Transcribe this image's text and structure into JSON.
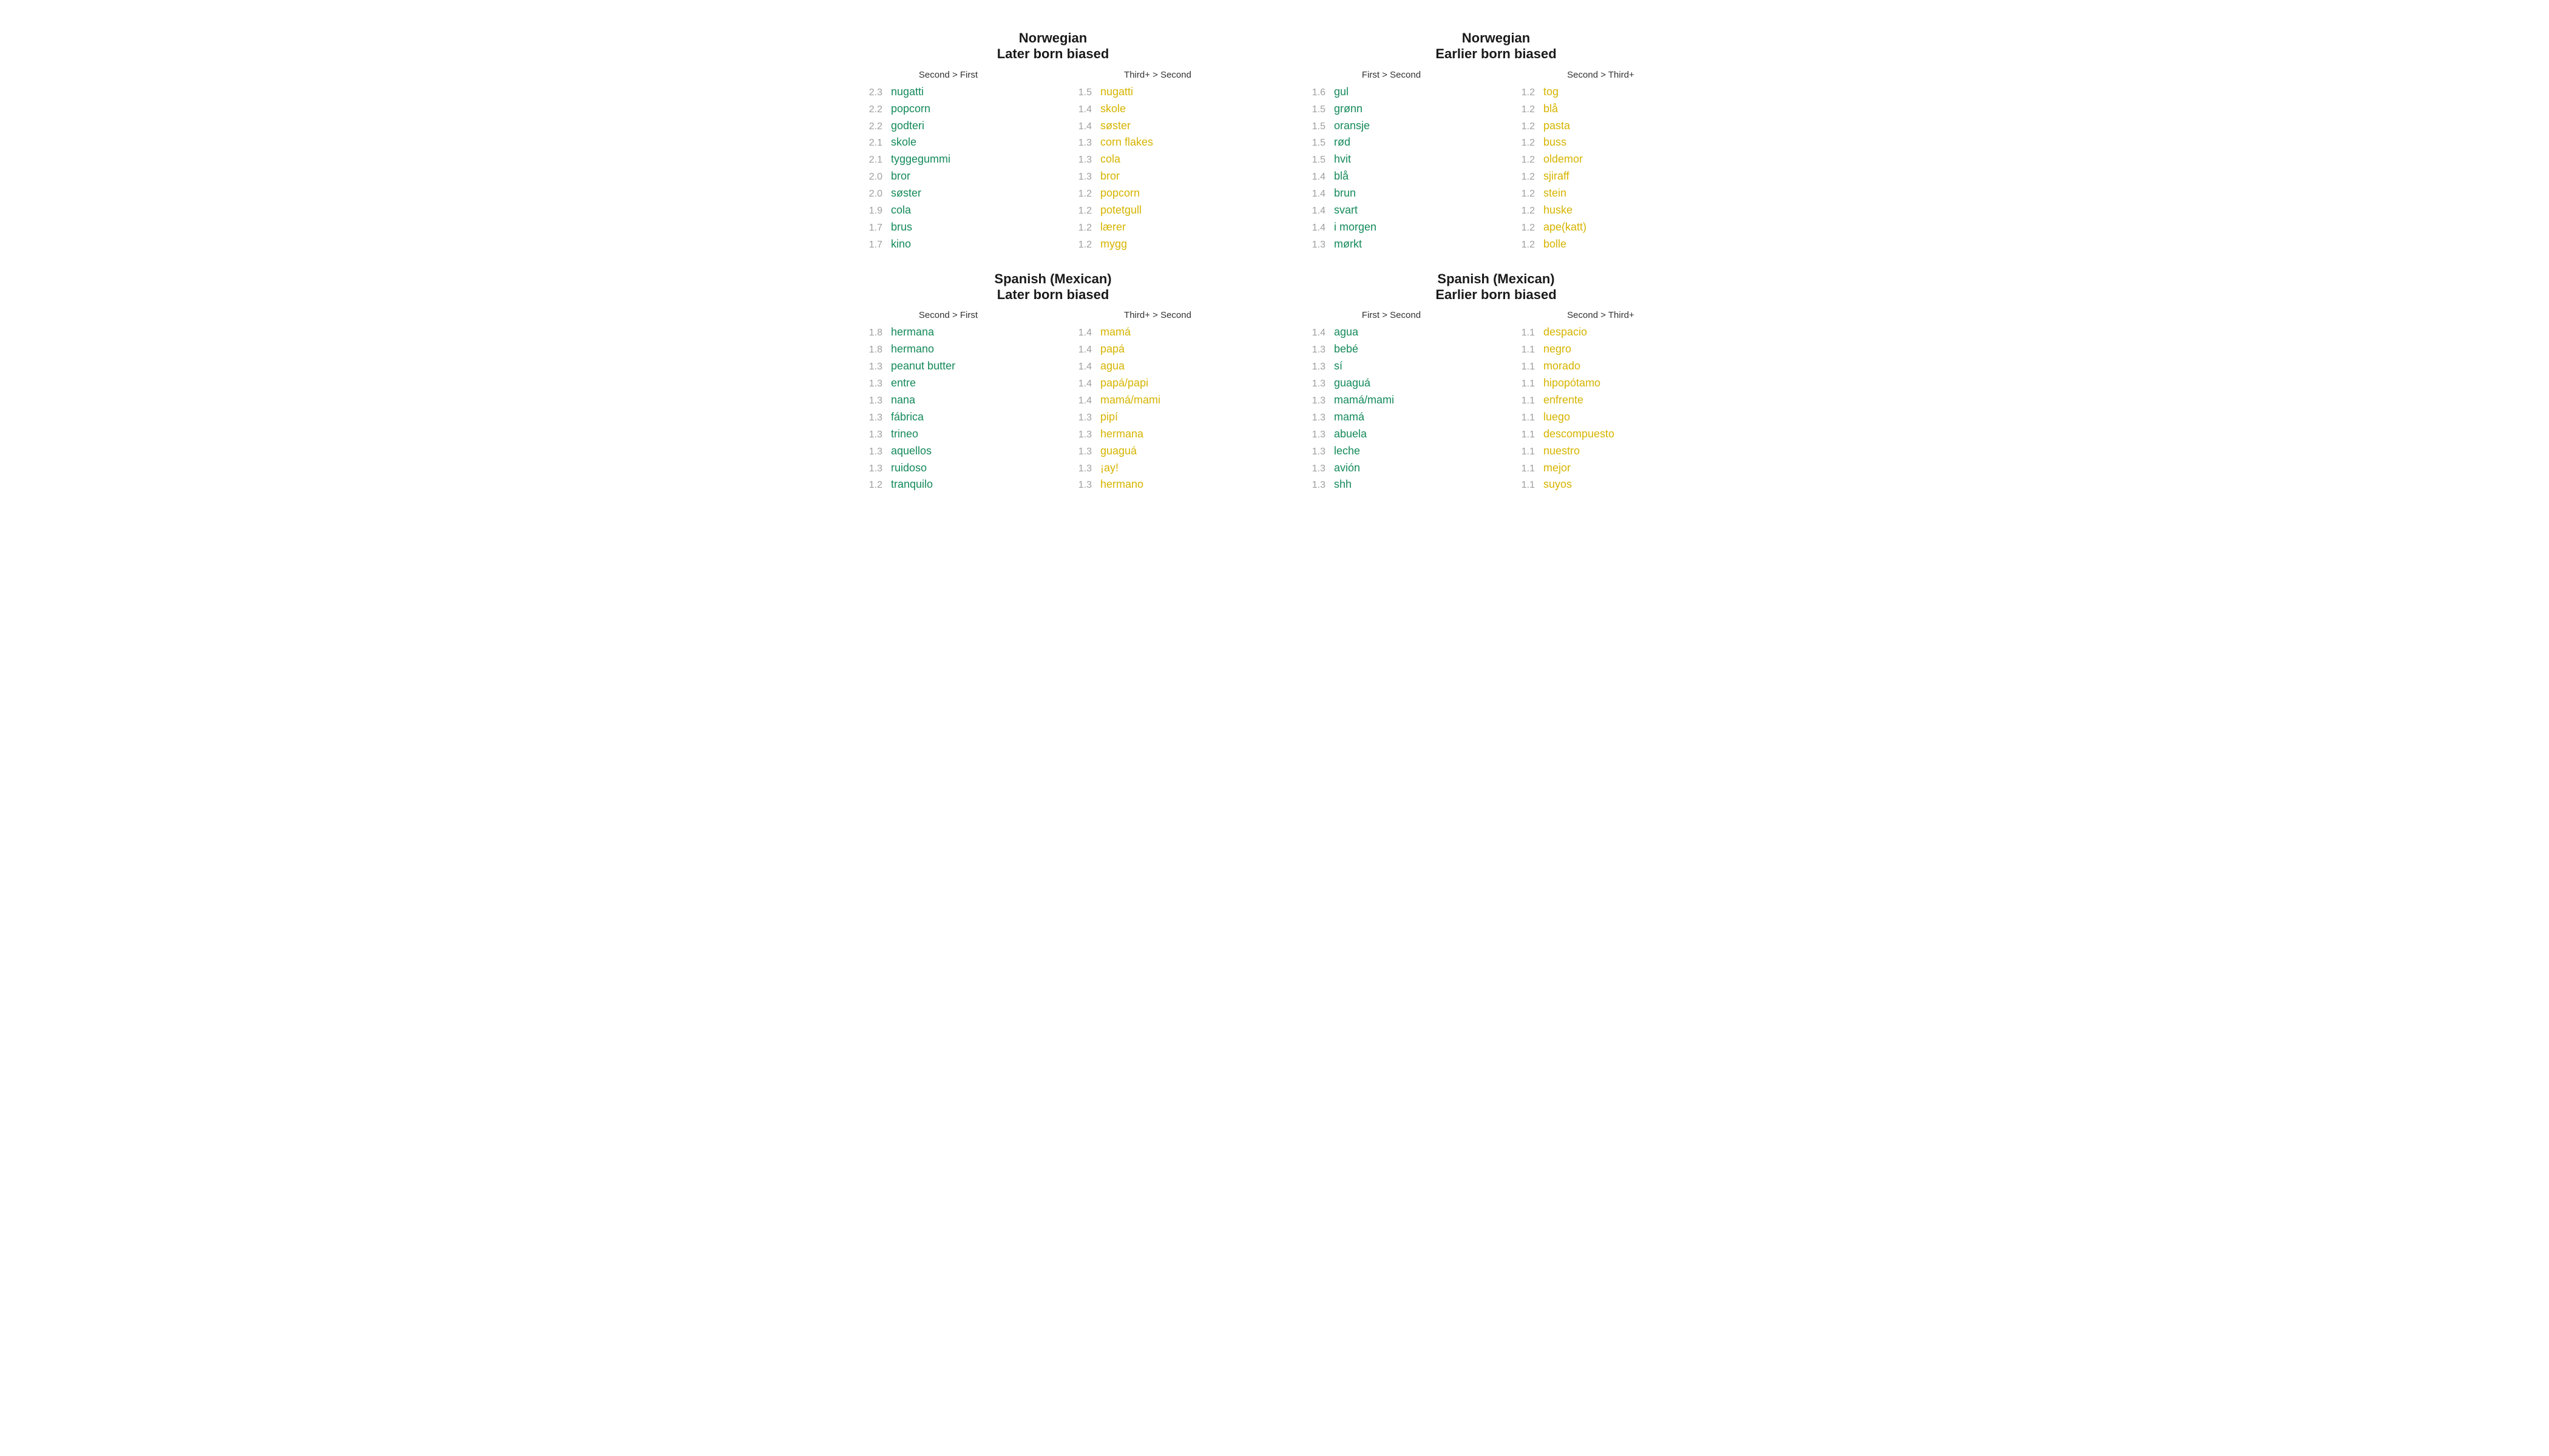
{
  "chart_data": {
    "type": "table",
    "panels": [
      {
        "id": "nor-later",
        "title_line1": "Norwegian",
        "title_line2": "Later born biased",
        "columns": [
          {
            "id": "nor-later-a",
            "header": "Second > First",
            "color": "green",
            "rows": [
              {
                "v": "2.3",
                "w": "nugatti"
              },
              {
                "v": "2.2",
                "w": "popcorn"
              },
              {
                "v": "2.2",
                "w": "godteri"
              },
              {
                "v": "2.1",
                "w": "skole"
              },
              {
                "v": "2.1",
                "w": "tyggegummi"
              },
              {
                "v": "2.0",
                "w": "bror"
              },
              {
                "v": "2.0",
                "w": "søster"
              },
              {
                "v": "1.9",
                "w": "cola"
              },
              {
                "v": "1.7",
                "w": "brus"
              },
              {
                "v": "1.7",
                "w": "kino"
              }
            ]
          },
          {
            "id": "nor-later-b",
            "header": "Third+ > Second",
            "color": "yellow",
            "rows": [
              {
                "v": "1.5",
                "w": "nugatti"
              },
              {
                "v": "1.4",
                "w": "skole"
              },
              {
                "v": "1.4",
                "w": "søster"
              },
              {
                "v": "1.3",
                "w": "corn flakes"
              },
              {
                "v": "1.3",
                "w": "cola"
              },
              {
                "v": "1.3",
                "w": "bror"
              },
              {
                "v": "1.2",
                "w": "popcorn"
              },
              {
                "v": "1.2",
                "w": "potetgull"
              },
              {
                "v": "1.2",
                "w": "lærer"
              },
              {
                "v": "1.2",
                "w": "mygg"
              }
            ]
          }
        ]
      },
      {
        "id": "nor-earlier",
        "title_line1": "Norwegian",
        "title_line2": "Earlier born biased",
        "columns": [
          {
            "id": "nor-earlier-a",
            "header": "First > Second",
            "color": "green",
            "rows": [
              {
                "v": "1.6",
                "w": "gul"
              },
              {
                "v": "1.5",
                "w": "grønn"
              },
              {
                "v": "1.5",
                "w": "oransje"
              },
              {
                "v": "1.5",
                "w": "rød"
              },
              {
                "v": "1.5",
                "w": "hvit"
              },
              {
                "v": "1.4",
                "w": "blå"
              },
              {
                "v": "1.4",
                "w": "brun"
              },
              {
                "v": "1.4",
                "w": "svart"
              },
              {
                "v": "1.4",
                "w": "i morgen"
              },
              {
                "v": "1.3",
                "w": "mørkt"
              }
            ]
          },
          {
            "id": "nor-earlier-b",
            "header": "Second > Third+",
            "color": "yellow",
            "rows": [
              {
                "v": "1.2",
                "w": "tog"
              },
              {
                "v": "1.2",
                "w": "blå"
              },
              {
                "v": "1.2",
                "w": "pasta"
              },
              {
                "v": "1.2",
                "w": "buss"
              },
              {
                "v": "1.2",
                "w": "oldemor"
              },
              {
                "v": "1.2",
                "w": "sjiraff"
              },
              {
                "v": "1.2",
                "w": "stein"
              },
              {
                "v": "1.2",
                "w": "huske"
              },
              {
                "v": "1.2",
                "w": "ape(katt)"
              },
              {
                "v": "1.2",
                "w": "bolle"
              }
            ]
          }
        ]
      },
      {
        "id": "spa-later",
        "title_line1": "Spanish (Mexican)",
        "title_line2": "Later born biased",
        "columns": [
          {
            "id": "spa-later-a",
            "header": "Second > First",
            "color": "green",
            "rows": [
              {
                "v": "1.8",
                "w": "hermana"
              },
              {
                "v": "1.8",
                "w": "hermano"
              },
              {
                "v": "1.3",
                "w": "peanut butter"
              },
              {
                "v": "1.3",
                "w": "entre"
              },
              {
                "v": "1.3",
                "w": "nana"
              },
              {
                "v": "1.3",
                "w": "fábrica"
              },
              {
                "v": "1.3",
                "w": "trineo"
              },
              {
                "v": "1.3",
                "w": "aquellos"
              },
              {
                "v": "1.3",
                "w": "ruidoso"
              },
              {
                "v": "1.2",
                "w": "tranquilo"
              }
            ]
          },
          {
            "id": "spa-later-b",
            "header": "Third+ > Second",
            "color": "yellow",
            "rows": [
              {
                "v": "1.4",
                "w": "mamá"
              },
              {
                "v": "1.4",
                "w": "papá"
              },
              {
                "v": "1.4",
                "w": "agua"
              },
              {
                "v": "1.4",
                "w": "papá/papi"
              },
              {
                "v": "1.4",
                "w": "mamá/mami"
              },
              {
                "v": "1.3",
                "w": "pipí"
              },
              {
                "v": "1.3",
                "w": "hermana"
              },
              {
                "v": "1.3",
                "w": "guaguá"
              },
              {
                "v": "1.3",
                "w": "¡ay!"
              },
              {
                "v": "1.3",
                "w": "hermano"
              }
            ]
          }
        ]
      },
      {
        "id": "spa-earlier",
        "title_line1": "Spanish (Mexican)",
        "title_line2": "Earlier born biased",
        "columns": [
          {
            "id": "spa-earlier-a",
            "header": "First > Second",
            "color": "green",
            "rows": [
              {
                "v": "1.4",
                "w": "agua"
              },
              {
                "v": "1.3",
                "w": "bebé"
              },
              {
                "v": "1.3",
                "w": "sí"
              },
              {
                "v": "1.3",
                "w": "guaguá"
              },
              {
                "v": "1.3",
                "w": "mamá/mami"
              },
              {
                "v": "1.3",
                "w": "mamá"
              },
              {
                "v": "1.3",
                "w": "abuela"
              },
              {
                "v": "1.3",
                "w": "leche"
              },
              {
                "v": "1.3",
                "w": "avión"
              },
              {
                "v": "1.3",
                "w": "shh"
              }
            ]
          },
          {
            "id": "spa-earlier-b",
            "header": "Second > Third+",
            "color": "yellow",
            "rows": [
              {
                "v": "1.1",
                "w": "despacio"
              },
              {
                "v": "1.1",
                "w": "negro"
              },
              {
                "v": "1.1",
                "w": "morado"
              },
              {
                "v": "1.1",
                "w": "hipopótamo"
              },
              {
                "v": "1.1",
                "w": "enfrente"
              },
              {
                "v": "1.1",
                "w": "luego"
              },
              {
                "v": "1.1",
                "w": "descompuesto"
              },
              {
                "v": "1.1",
                "w": "nuestro"
              },
              {
                "v": "1.1",
                "w": "mejor"
              },
              {
                "v": "1.1",
                "w": "suyos"
              }
            ]
          }
        ]
      }
    ]
  }
}
